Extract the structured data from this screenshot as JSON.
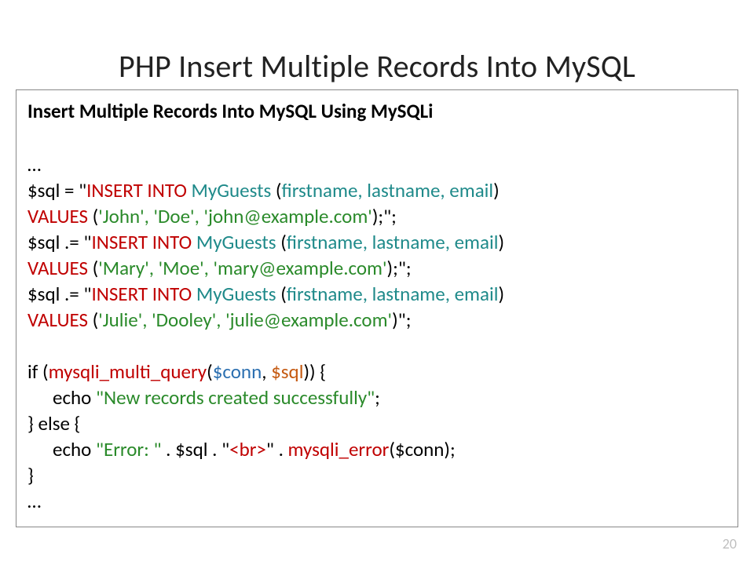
{
  "title": "PHP Insert Multiple Records Into MySQL",
  "subtitle": "Insert Multiple Records Into MySQL Using MySQLi",
  "page_number": "20",
  "code": {
    "ellipsis": "…",
    "sql_var": "$sql",
    "eq": " = ",
    "dot_eq": " .= ",
    "q": "\"",
    "insert_into": "INSERT INTO ",
    "table": "MyGuests",
    "space": " ",
    "open_paren": "(",
    "cols": "firstname, lastname, email",
    "close_paren": ")",
    "values": "VALUES ",
    "row1": "'John', 'Doe', 'john@example.com'",
    "row2": "'Mary', 'Moe', 'mary@example.com'",
    "row3": "'Julie', 'Dooley', 'julie@example.com'",
    "tail_semi_inside": ");",
    "tail_close_only": ")",
    "line_end": ";",
    "stmt_close": "\";",
    "if_open": "if (",
    "multi_query": "mysqli_multi_query",
    "args_open": "(",
    "conn": "$conn",
    "comma_sp": ", ",
    "args_close": ")",
    "if_tail": ") {",
    "echo": "echo ",
    "success_str": "\"New records created successfully\"",
    "semi": ";",
    "else": "} else {",
    "error_prefix": "\"Error: \"",
    "concat": " . ",
    "br_open": "\"",
    "br_tag": "<br>",
    "br_close": "\"",
    "mysqli_error": "mysqli_error",
    "err_args": "($conn);",
    "close_brace": "}"
  }
}
